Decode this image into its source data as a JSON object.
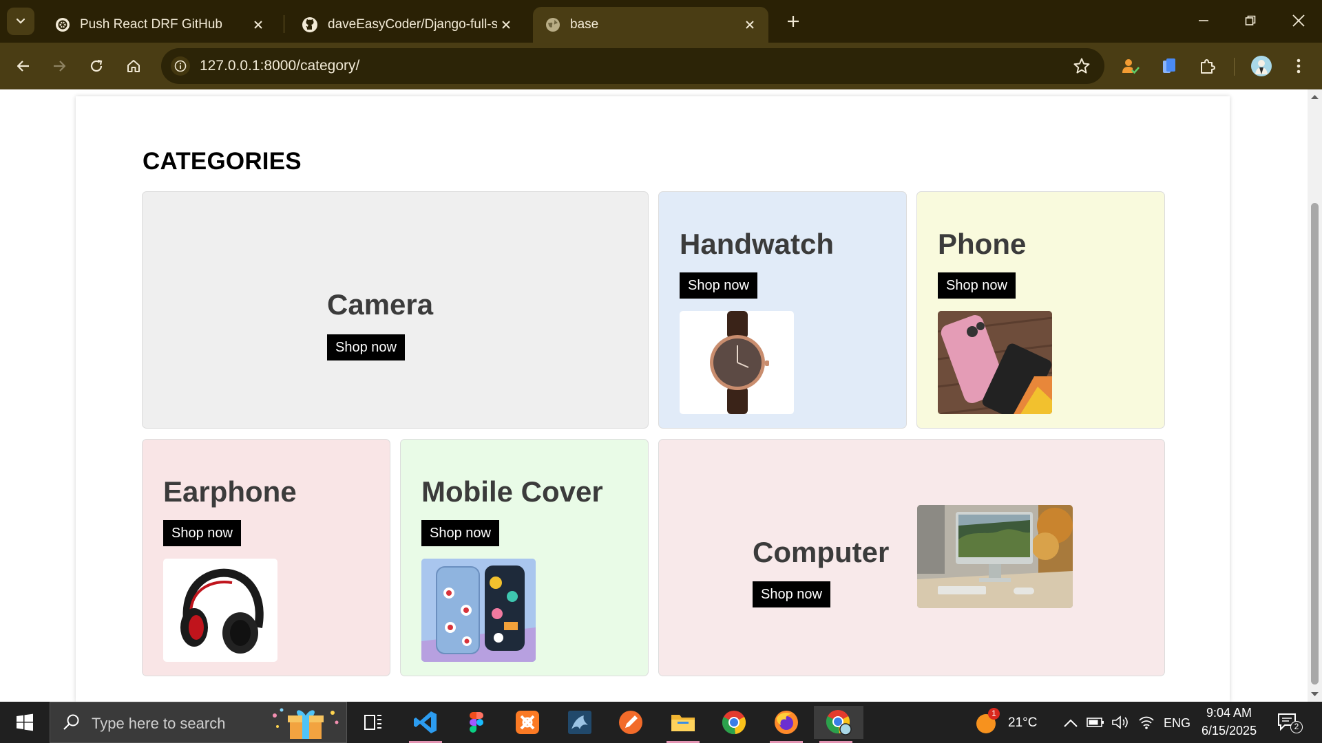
{
  "browser": {
    "tabs": [
      {
        "title": "Push React DRF GitHub",
        "icon": "openai-icon"
      },
      {
        "title": "daveEasyCoder/Django-full-stack",
        "icon": "github-icon"
      },
      {
        "title": "base",
        "icon": "globe-icon",
        "active": true
      }
    ],
    "url": "127.0.0.1:8000/category/"
  },
  "page": {
    "title": "CATEGORIES",
    "categories": [
      {
        "name": "Camera",
        "button": "Shop now",
        "bg": "#efefef"
      },
      {
        "name": "Handwatch",
        "button": "Shop now",
        "bg": "#e1ebf8"
      },
      {
        "name": "Phone",
        "button": "Shop now",
        "bg": "#f9fadd"
      },
      {
        "name": "Earphone",
        "button": "Shop now",
        "bg": "#f9e5e6"
      },
      {
        "name": "Mobile Cover",
        "button": "Shop now",
        "bg": "#e9fbe7"
      },
      {
        "name": "Computer",
        "button": "Shop now",
        "bg": "#f8e9ea"
      }
    ]
  },
  "taskbar": {
    "search_placeholder": "Type here to search",
    "weather": {
      "temp": "21°C",
      "badge": "1"
    },
    "language": "ENG",
    "time": "9:04 AM",
    "date": "6/15/2025",
    "notifications": "2"
  }
}
